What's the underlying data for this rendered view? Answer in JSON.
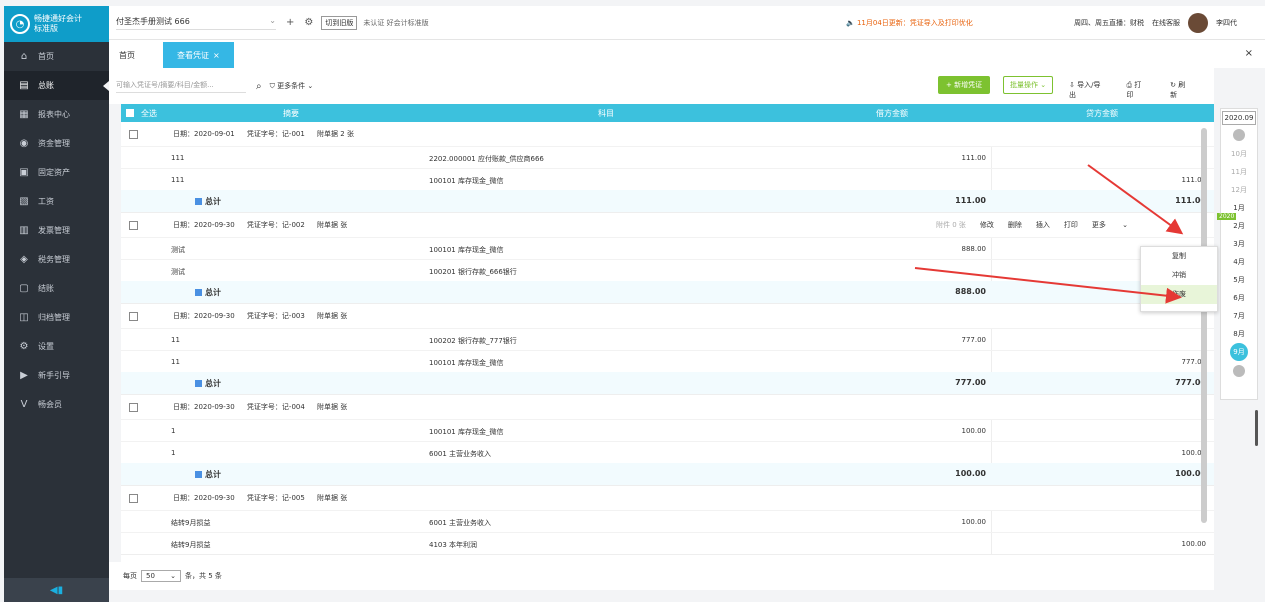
{
  "app": {
    "logo_line1": "畅捷通好会计",
    "logo_line2": "标准版"
  },
  "sidebar": {
    "items": [
      {
        "label": "首页",
        "icon": "home-icon"
      },
      {
        "label": "总账",
        "icon": "ledger-icon"
      },
      {
        "label": "报表中心",
        "icon": "report-icon"
      },
      {
        "label": "资金管理",
        "icon": "fund-icon"
      },
      {
        "label": "固定资产",
        "icon": "asset-icon"
      },
      {
        "label": "工资",
        "icon": "salary-icon"
      },
      {
        "label": "发票管理",
        "icon": "invoice-icon"
      },
      {
        "label": "税务管理",
        "icon": "tax-icon"
      },
      {
        "label": "结账",
        "icon": "close-books-icon"
      },
      {
        "label": "归档管理",
        "icon": "archive-icon"
      },
      {
        "label": "设置",
        "icon": "gear-icon"
      },
      {
        "label": "新手引导",
        "icon": "guide-icon"
      },
      {
        "label": "畅会员",
        "icon": "vip-icon"
      }
    ]
  },
  "topbar": {
    "account": "付圣杰手册测试 666",
    "old_version": "切到旧版",
    "uncertified": "未认证",
    "standard": "好会计标准版",
    "notice": "11月04日更新：凭证导入及打印优化",
    "live": "周四、周五直播：财税",
    "service": "在线客服",
    "user": "李四代"
  },
  "tabs": {
    "home": "首页",
    "active": "查看凭证",
    "active_close": "×",
    "close_all": "×"
  },
  "toolbar": {
    "search_placeholder": "可输入凭证号/摘要/科目/金额...",
    "more_filters": "更多条件",
    "new_voucher": "+ 新增凭证",
    "batch": "批量操作",
    "import_export": "导入/导出",
    "print": "打印",
    "refresh": "刷新"
  },
  "table": {
    "select_all": "全选",
    "col_summary": "摘要",
    "col_subject": "科目",
    "col_debit": "借方金额",
    "col_credit": "贷方金额",
    "total_label": "总计"
  },
  "vouchers": [
    {
      "date": "日期：2020-09-01",
      "no": "凭证字号：记-001",
      "attach": "附单据 2 张",
      "rows": [
        {
          "summary": "111",
          "subject": "2202.000001 应付账款_供应商666",
          "debit": "111.00",
          "credit": ""
        },
        {
          "summary": "111",
          "subject": "100101 库存现金_微信",
          "debit": "",
          "credit": "111.00"
        }
      ],
      "total_debit": "111.00",
      "total_credit": "111.00"
    },
    {
      "date": "日期：2020-09-30",
      "no": "凭证字号：记-002",
      "attach": "附单据 张",
      "rows": [
        {
          "summary": "测试",
          "subject": "100101 库存现金_微信",
          "debit": "888.00",
          "credit": ""
        },
        {
          "summary": "测试",
          "subject": "100201 银行存款_666银行",
          "debit": "",
          "credit": ""
        }
      ],
      "total_debit": "888.00",
      "total_credit": ""
    },
    {
      "date": "日期：2020-09-30",
      "no": "凭证字号：记-003",
      "attach": "附单据 张",
      "rows": [
        {
          "summary": "11",
          "subject": "100202 银行存款_777银行",
          "debit": "777.00",
          "credit": ""
        },
        {
          "summary": "11",
          "subject": "100101 库存现金_微信",
          "debit": "",
          "credit": "777.00"
        }
      ],
      "total_debit": "777.00",
      "total_credit": "777.00"
    },
    {
      "date": "日期：2020-09-30",
      "no": "凭证字号：记-004",
      "attach": "附单据 张",
      "rows": [
        {
          "summary": "1",
          "subject": "100101 库存现金_微信",
          "debit": "100.00",
          "credit": ""
        },
        {
          "summary": "1",
          "subject": "6001 主营业务收入",
          "debit": "",
          "credit": "100.00"
        }
      ],
      "total_debit": "100.00",
      "total_credit": "100.00"
    },
    {
      "date": "日期：2020-09-30",
      "no": "凭证字号：记-005",
      "attach": "附单据 张",
      "rows": [
        {
          "summary": "结转9月损益",
          "subject": "6001 主营业务收入",
          "debit": "100.00",
          "credit": ""
        },
        {
          "summary": "结转9月损益",
          "subject": "4103 本年利润",
          "debit": "",
          "credit": "100.00"
        }
      ],
      "total_debit": "",
      "total_credit": ""
    }
  ],
  "row_actions": {
    "attachment": "附件 0 张",
    "edit": "修改",
    "delete": "删除",
    "insert": "插入",
    "print": "打印",
    "more": "更多"
  },
  "dropdown": {
    "items": [
      "复制",
      "冲销",
      "作废"
    ],
    "highlighted": "作废"
  },
  "footer": {
    "per_page_label": "每页",
    "per_page": "50",
    "summary": "条，共 5 条"
  },
  "month_picker": {
    "year": "2020.09",
    "year_tag": "2020",
    "months": [
      "10月",
      "11月",
      "12月",
      "1月",
      "2月",
      "3月",
      "4月",
      "5月",
      "6月",
      "7月",
      "8月"
    ],
    "selected": "9月"
  },
  "colors": {
    "accent": "#3cc1dd",
    "sidebar_bg": "#2b3139",
    "green": "#7dc230",
    "arrow_red": "#e53935"
  }
}
